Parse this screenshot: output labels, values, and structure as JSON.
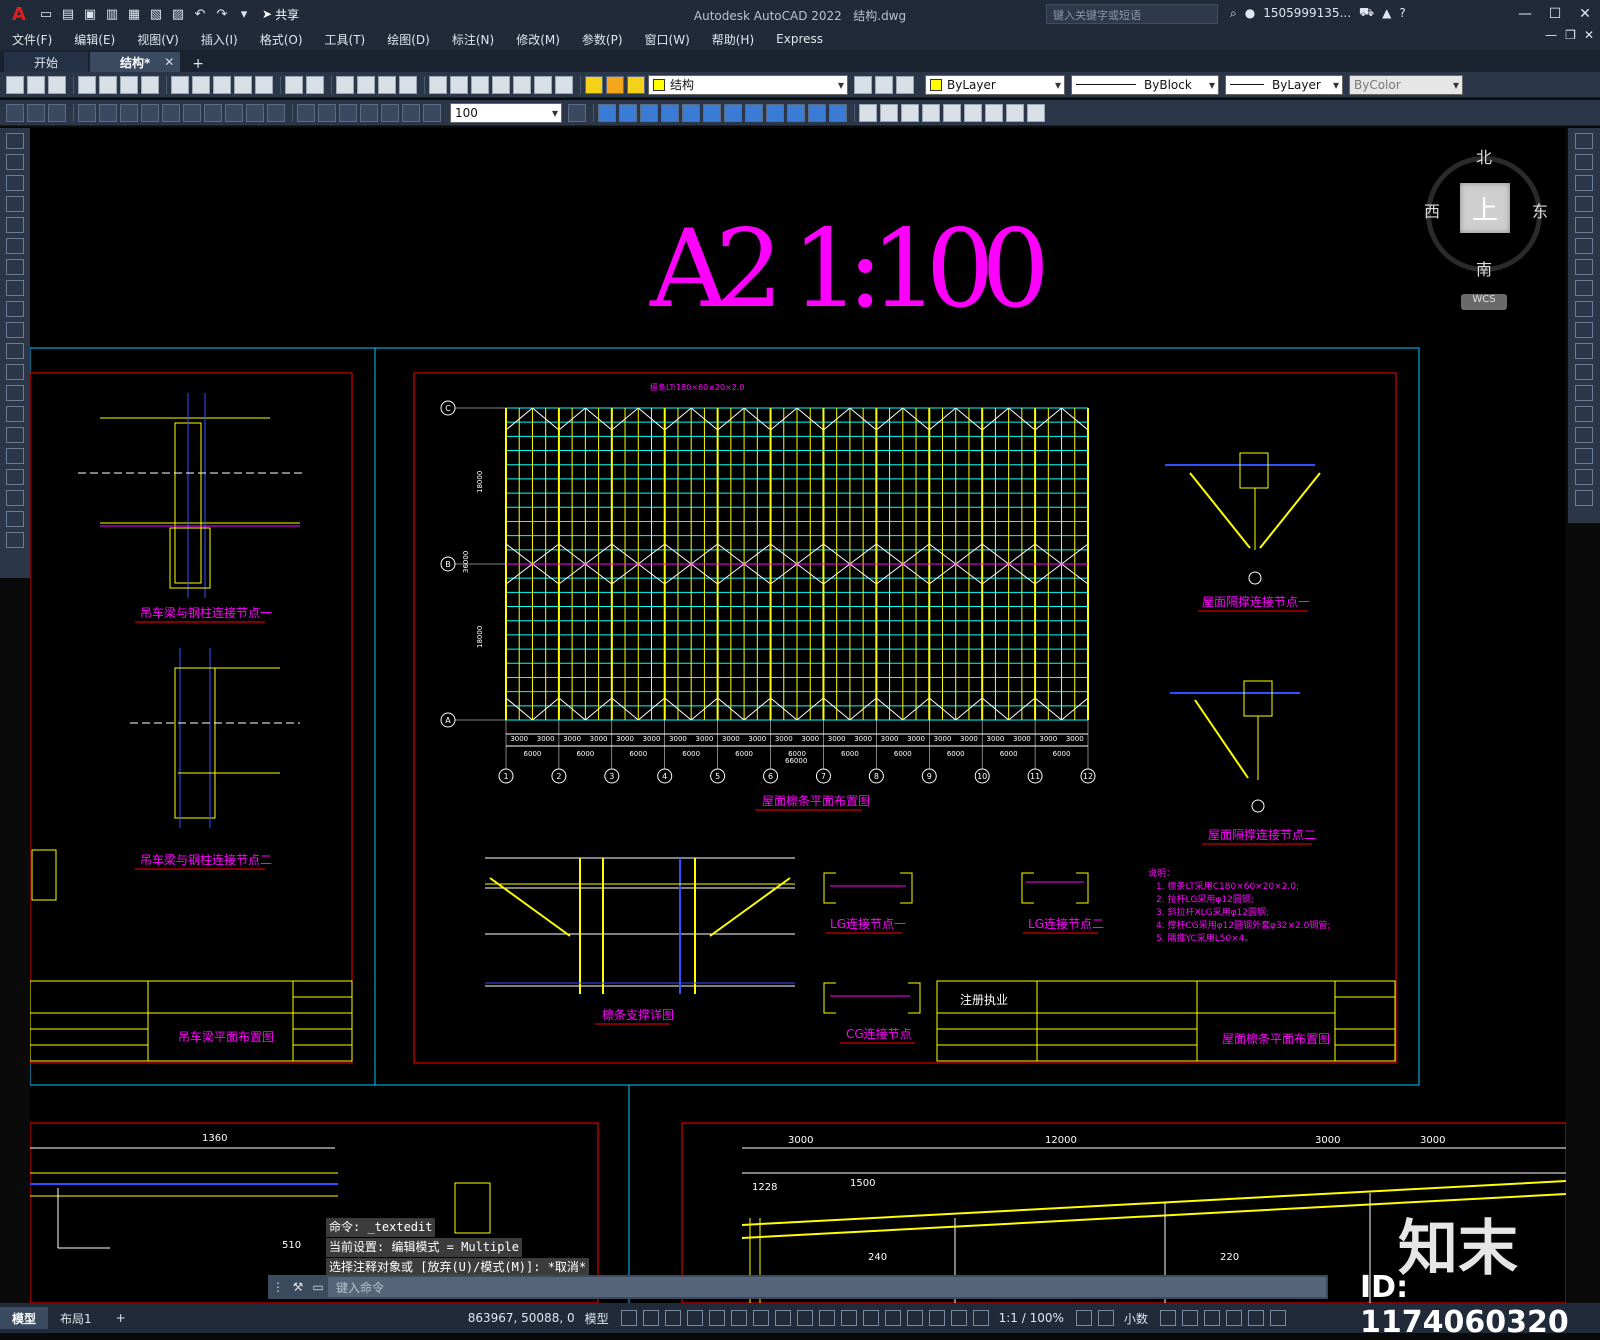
{
  "app": {
    "title": "Autodesk AutoCAD 2022",
    "file": "结构.dwg",
    "share_label": "共享",
    "search_placeholder": "键入关键字或短语",
    "user": "1505999135...",
    "logo_letter": "A"
  },
  "menu": [
    "文件(F)",
    "编辑(E)",
    "视图(V)",
    "插入(I)",
    "格式(O)",
    "工具(T)",
    "绘图(D)",
    "标注(N)",
    "修改(M)",
    "参数(P)",
    "窗口(W)",
    "帮助(H)",
    "Express"
  ],
  "tabs": [
    {
      "label": "开始",
      "active": false
    },
    {
      "label": "结构*",
      "active": true
    }
  ],
  "toolbar": {
    "layer": "结构",
    "color": "ByLayer",
    "linetype": "ByBlock",
    "lineweight": "ByLayer",
    "plotstyle": "ByColor",
    "scale_value": "100"
  },
  "viewcube": {
    "top": "上",
    "north": "北",
    "south": "南",
    "east": "东",
    "west": "西",
    "wcs": "WCS"
  },
  "drawing": {
    "big_title": "A2 1:100",
    "left_titles": [
      "吊车梁与钢柱连接节点一",
      "吊车梁与钢柱连接节点二"
    ],
    "left_sheet_title": "吊车梁平面布置图",
    "plan_title": "屋面檩条平面布置图",
    "plan_top_label": "檩条LT:180×60×20×2.0",
    "axis_numbers": [
      "1",
      "2",
      "3",
      "4",
      "5",
      "6",
      "7",
      "8",
      "9",
      "10",
      "11",
      "12"
    ],
    "axis_letters": [
      "C",
      "B",
      "A"
    ],
    "bay_dim": "6000",
    "half_dim": "3000",
    "total_dim": "66000",
    "side_dims": [
      "18000",
      "36000",
      "18000"
    ],
    "node_titles": [
      "屋面隔撑连接节点一",
      "屋面隔撑连接节点二"
    ],
    "detail_titles": [
      "檩条支撑详图",
      "LG连接节点一",
      "LG连接节点二",
      "CG连接节点"
    ],
    "notes_title": "说明：",
    "notes": [
      "1. 檩条LT采用C180×60×20×2.0;",
      "2. 拉杆LG采用φ12圆钢;",
      "3. 斜拉杆XLG采用φ12圆钢;",
      "4. 撑杆CG采用φ12圆钢外套φ32×2.0钢管;",
      "5. 隅撑YC采用L50×4。"
    ],
    "stamp_label": "注册执业",
    "right_sheet_title": "屋面檩条平面布置图",
    "bottom_dims": [
      "1360",
      "3000",
      "12000",
      "3000",
      "3000",
      "1500",
      "1228",
      "240",
      "220",
      "510"
    ]
  },
  "command": {
    "history": [
      "命令: _textedit",
      "当前设置: 编辑模式 = Multiple",
      "选择注释对象或 [放弃(U)/模式(M)]: *取消*"
    ],
    "placeholder": "键入命令"
  },
  "status": {
    "tabs": [
      {
        "label": "模型",
        "active": true
      },
      {
        "label": "布局1",
        "active": false
      }
    ],
    "coords": "863967, 50088, 0",
    "mode": "模型",
    "annoscale": "1:1 / 100%",
    "units": "小数"
  },
  "watermark": {
    "brand": "知末",
    "id": "ID: 1174060320"
  },
  "colors": {
    "magenta": "#ff00ff",
    "yellow": "#ffff00",
    "cyan": "#00ffff",
    "red": "#ff0000",
    "blue": "#3050ff",
    "green": "#00ff00",
    "bg": "#000000"
  }
}
